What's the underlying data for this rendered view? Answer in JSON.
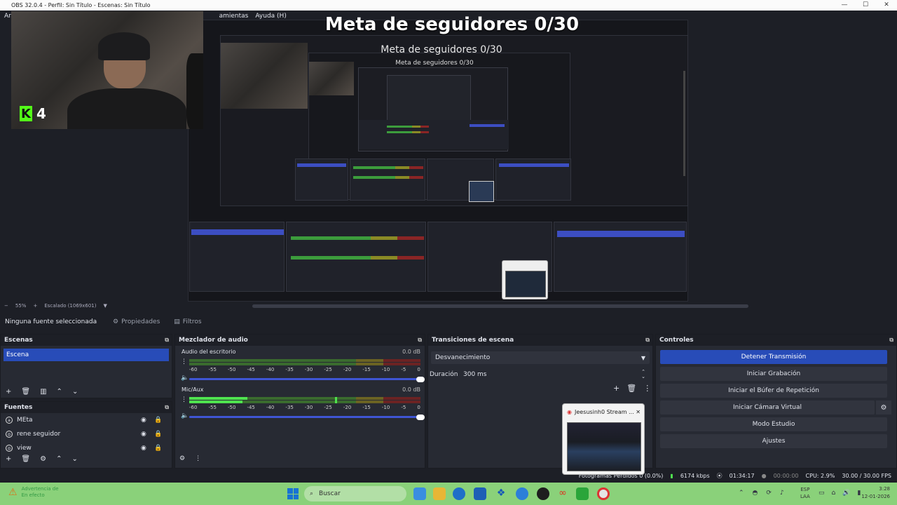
{
  "window": {
    "title": "OBS 32.0.4 - Perfil: Sin Título - Escenas: Sin Título",
    "minimize": "—",
    "maximize": "☐",
    "close": "✕"
  },
  "menu": {
    "arc": "Arc",
    "tools": "amientas",
    "help": "Ayuda (H)"
  },
  "preview": {
    "goal_text": "Meta de seguidores 0/30",
    "nested_goal": "Meta de seguidores 0/30",
    "nested_goal_small": "Meta de seguidores 0/30",
    "badge_number": "4",
    "badge_letter": "K"
  },
  "preview_status": {
    "zoom": "55%",
    "scale": "Escalado (1069x601)"
  },
  "source_toolbar": {
    "no_source": "Ninguna fuente seleccionada",
    "properties": "Propiedades",
    "filters": "Filtros"
  },
  "scenes": {
    "title": "Escenas",
    "items": [
      "Escena"
    ]
  },
  "sources": {
    "title": "Fuentes",
    "items": [
      "MEta",
      "rene seguidor",
      "view"
    ]
  },
  "mixer": {
    "title": "Mezclador de audio",
    "channels": [
      {
        "name": "Audio del escritorio",
        "db": "0.0 dB",
        "level": 0.0
      },
      {
        "name": "Mic/Aux",
        "db": "0.0 dB",
        "level": 0.25
      }
    ],
    "ticks": [
      "-60",
      "-55",
      "-50",
      "-45",
      "-40",
      "-35",
      "-30",
      "-25",
      "-20",
      "-15",
      "-10",
      "-5",
      "0"
    ]
  },
  "transitions": {
    "title": "Transiciones de escena",
    "selected": "Desvanecimiento",
    "duration_label": "Duración",
    "duration_value": "300 ms"
  },
  "controls": {
    "title": "Controles",
    "buttons": [
      "Detener Transmisión",
      "Iniciar Grabación",
      "Iniciar el Búfer de Repetición",
      "Iniciar Cámara Virtual",
      "Modo Estudio",
      "Ajustes"
    ]
  },
  "status": {
    "frames": "Fotogramas Perdidos 0 (0.0%)",
    "bitrate": "6174 kbps",
    "stream_time": "01:34:17",
    "rec_time": "00:00:00",
    "cpu": "CPU: 2.9%",
    "fps": "30.00 / 30.00 FPS"
  },
  "popup": {
    "title": "Jeesusinh0 Stream ..."
  },
  "taskbar": {
    "warning_line1": "Advertencia de",
    "warning_line2": "En efecto",
    "search": "Buscar",
    "lang_top": "ESP",
    "lang_bottom": "LAA",
    "time": "3:28",
    "date": "12-01-2026"
  }
}
